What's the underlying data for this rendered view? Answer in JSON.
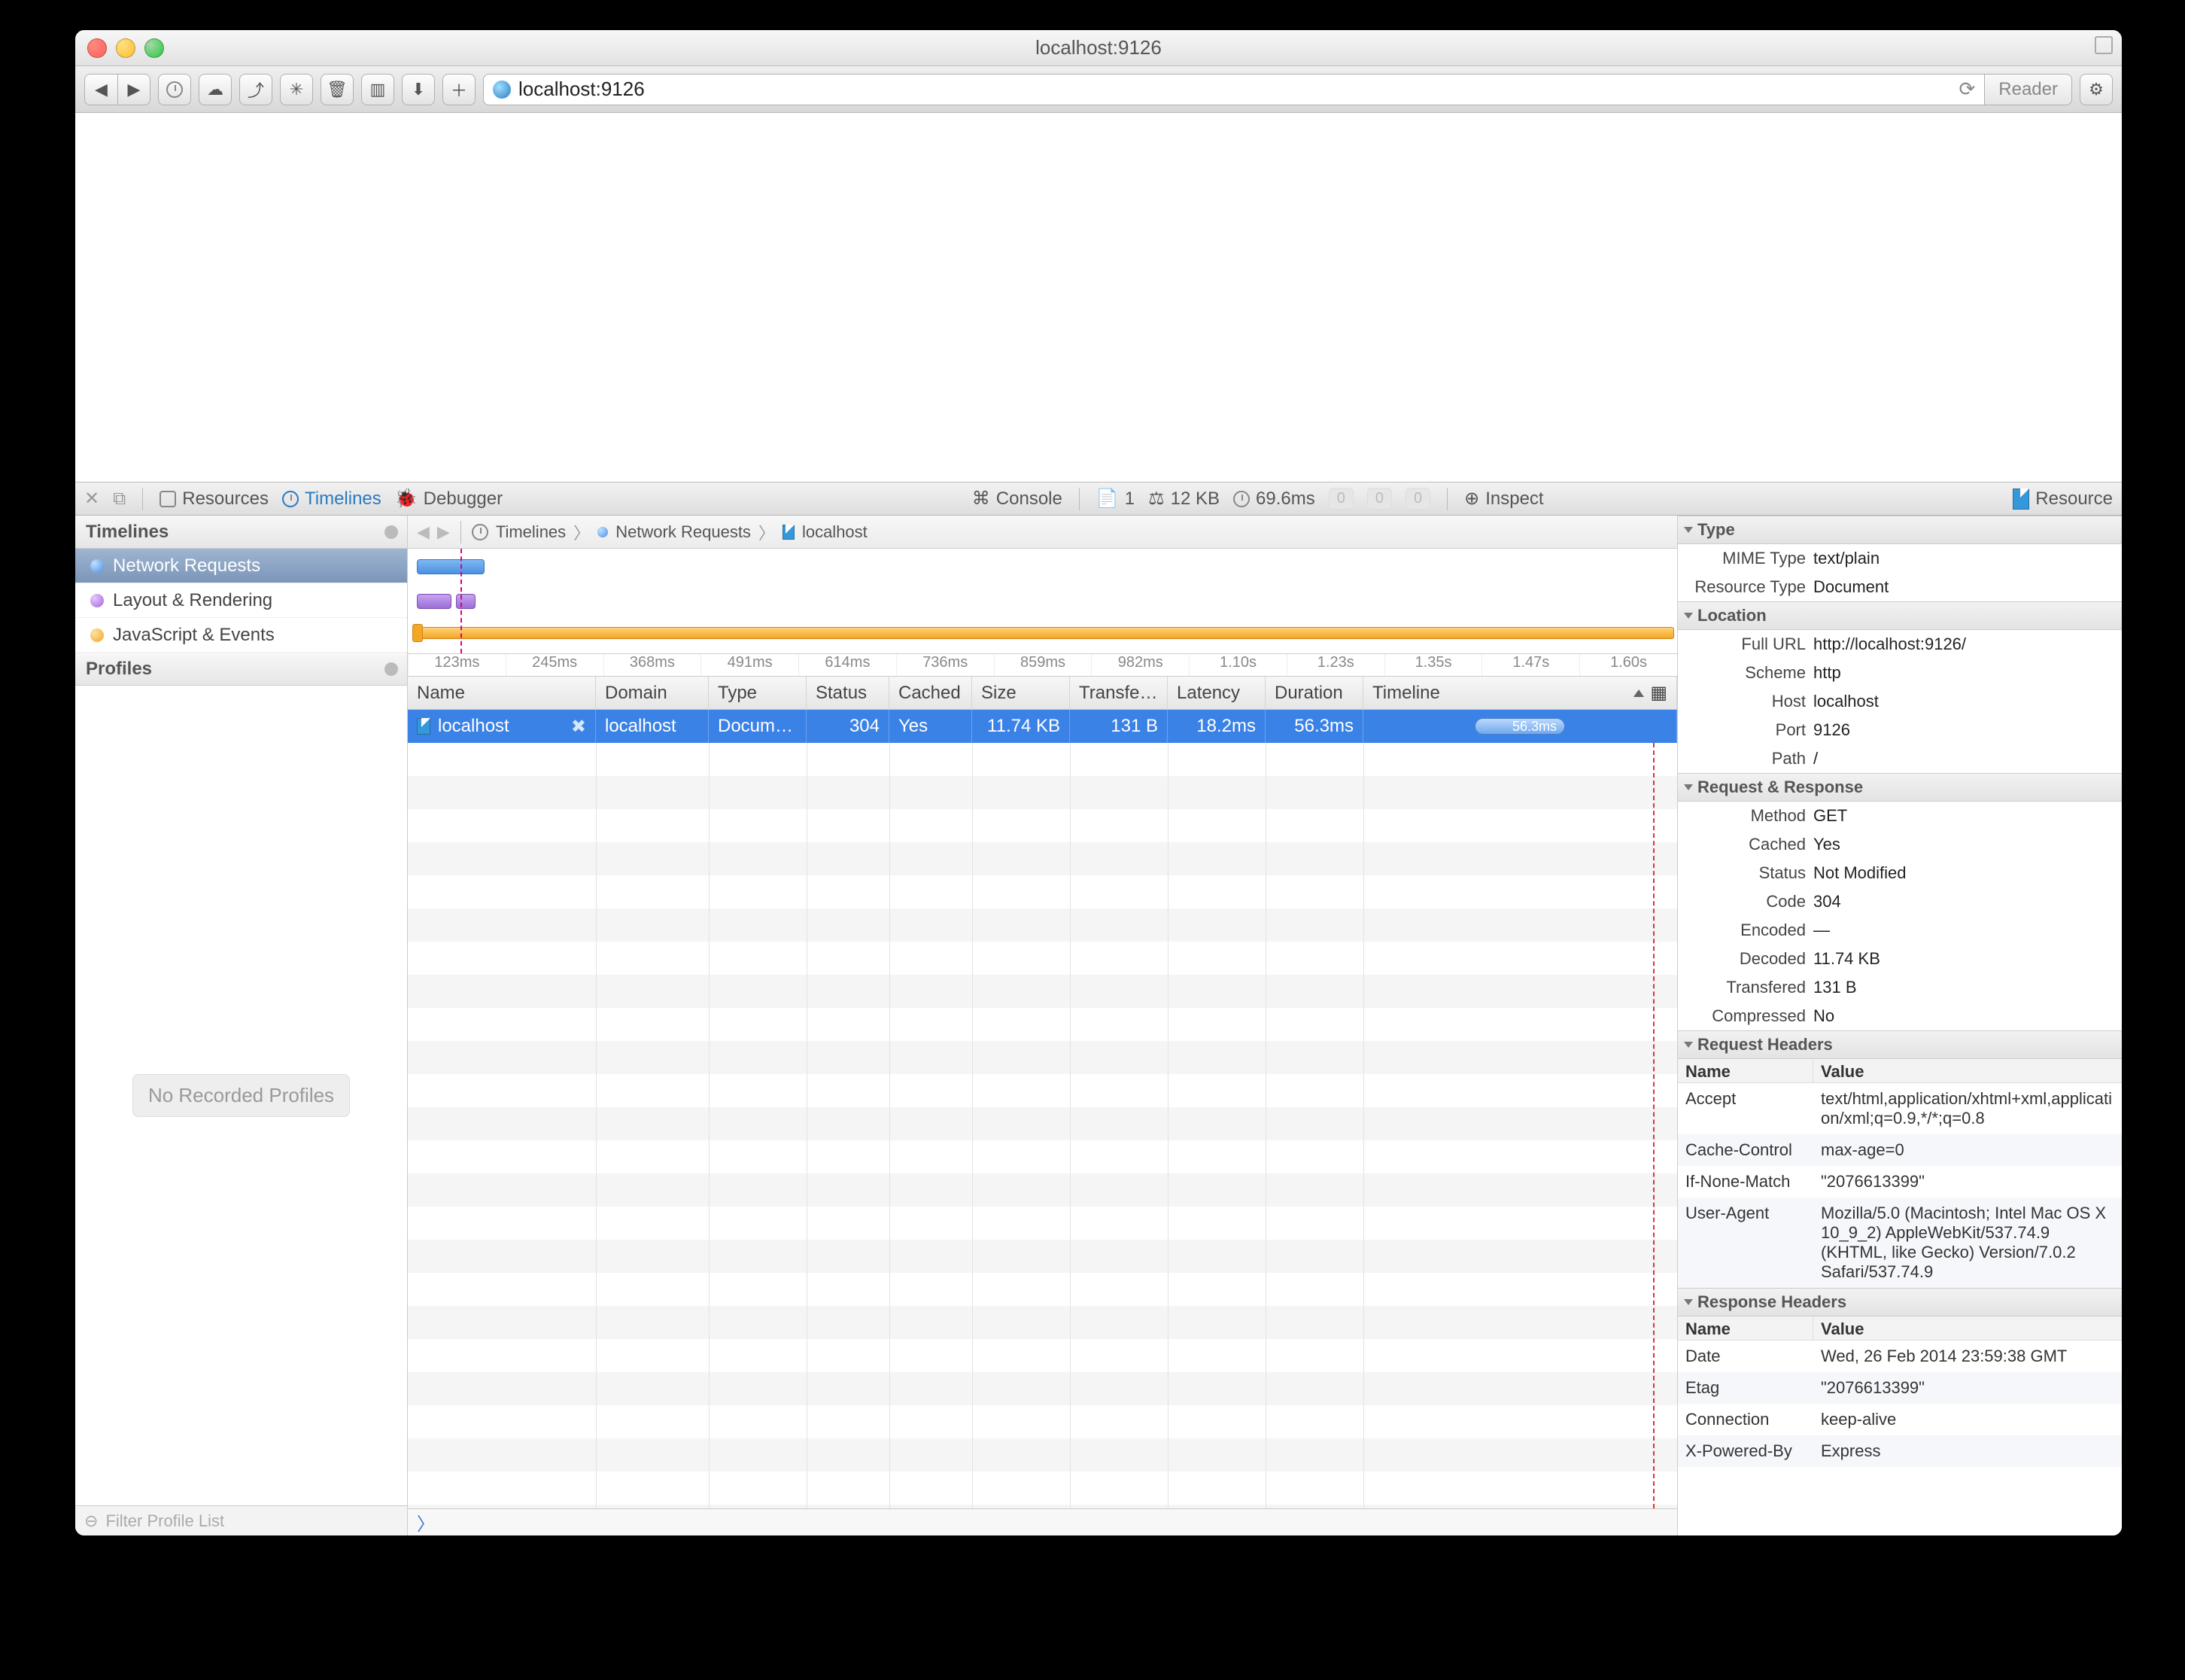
{
  "title": "localhost:9126",
  "url_display": "localhost:9126",
  "reader_label": "Reader",
  "toolbar": {
    "resources": "Resources",
    "timelines": "Timelines",
    "debugger": "Debugger",
    "console": "Console",
    "doc_count": "1",
    "size": "12 KB",
    "time": "69.6ms",
    "msg0a": "0",
    "msg0b": "0",
    "msg0c": "0",
    "inspect": "Inspect",
    "resource": "Resource"
  },
  "sidebar": {
    "header1": "Timelines",
    "items": [
      {
        "label": "Network Requests"
      },
      {
        "label": "Layout & Rendering"
      },
      {
        "label": "JavaScript & Events"
      }
    ],
    "header2": "Profiles",
    "no_profiles": "No Recorded Profiles",
    "filter_placeholder": "Filter Profile List"
  },
  "breadcrumb": [
    "Timelines",
    "Network Requests",
    "localhost"
  ],
  "ruler": [
    "123ms",
    "245ms",
    "368ms",
    "491ms",
    "614ms",
    "736ms",
    "859ms",
    "982ms",
    "1.10s",
    "1.23s",
    "1.35s",
    "1.47s",
    "1.60s"
  ],
  "columns": [
    "Name",
    "Domain",
    "Type",
    "Status",
    "Cached",
    "Size",
    "Transfe…",
    "Latency",
    "Duration",
    "Timeline"
  ],
  "row": {
    "name": "localhost",
    "domain": "localhost",
    "type": "Docum…",
    "status": "304",
    "cached": "Yes",
    "size": "11.74 KB",
    "transferred": "131 B",
    "latency": "18.2ms",
    "duration": "56.3ms",
    "pill_label": "56.3ms"
  },
  "details": {
    "type_h": "Type",
    "mime_k": "MIME Type",
    "mime_v": "text/plain",
    "rtype_k": "Resource Type",
    "rtype_v": "Document",
    "loc_h": "Location",
    "url_k": "Full URL",
    "url_v": "http://localhost:9126/",
    "scheme_k": "Scheme",
    "scheme_v": "http",
    "host_k": "Host",
    "host_v": "localhost",
    "port_k": "Port",
    "port_v": "9126",
    "path_k": "Path",
    "path_v": "/",
    "rr_h": "Request & Response",
    "method_k": "Method",
    "method_v": "GET",
    "cached_k": "Cached",
    "cached_v": "Yes",
    "status_k": "Status",
    "status_v": "Not Modified",
    "code_k": "Code",
    "code_v": "304",
    "enc_k": "Encoded",
    "enc_v": "—",
    "dec_k": "Decoded",
    "dec_v": "11.74 KB",
    "trans_k": "Transfered",
    "trans_v": "131 B",
    "comp_k": "Compressed",
    "comp_v": "No",
    "reqh_h": "Request Headers",
    "hname": "Name",
    "hvalue": "Value",
    "req_headers": [
      {
        "k": "Accept",
        "v": "text/html,application/xhtml+xml,application/xml;q=0.9,*/*;q=0.8"
      },
      {
        "k": "Cache-Control",
        "v": "max-age=0"
      },
      {
        "k": "If-None-Match",
        "v": "\"2076613399\""
      },
      {
        "k": "User-Agent",
        "v": "Mozilla/5.0 (Macintosh; Intel Mac OS X 10_9_2) AppleWebKit/537.74.9 (KHTML, like Gecko) Version/7.0.2 Safari/537.74.9"
      }
    ],
    "resh_h": "Response Headers",
    "res_headers": [
      {
        "k": "Date",
        "v": "Wed, 26 Feb 2014 23:59:38 GMT"
      },
      {
        "k": "Etag",
        "v": "\"2076613399\""
      },
      {
        "k": "Connection",
        "v": "keep-alive"
      },
      {
        "k": "X-Powered-By",
        "v": "Express"
      }
    ]
  }
}
